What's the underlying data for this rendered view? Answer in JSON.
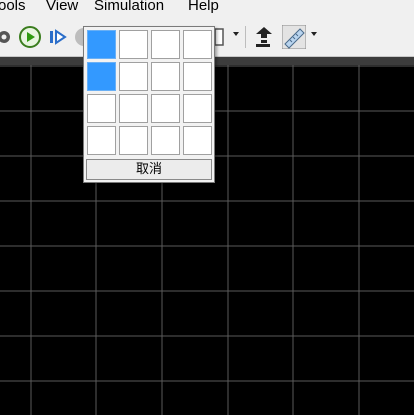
{
  "menubar": {
    "items": [
      "ools",
      "View",
      "Simulation",
      "Help"
    ]
  },
  "toolbar": {
    "icons": [
      "settings-icon",
      "run-icon",
      "step-forward-icon",
      "stop-icon",
      "panel-icon",
      "dropdown-icon",
      "import-icon",
      "ruler-icon",
      "dropdown-icon"
    ]
  },
  "layout_chooser": {
    "rows": 4,
    "cols": 4,
    "selected_rows": 2,
    "selected_cols": 1,
    "cancel_label": "取消"
  },
  "colors": {
    "canvas_bg": "#000000",
    "grid": "#5a5a5a",
    "selected_cell": "#3399ff"
  }
}
